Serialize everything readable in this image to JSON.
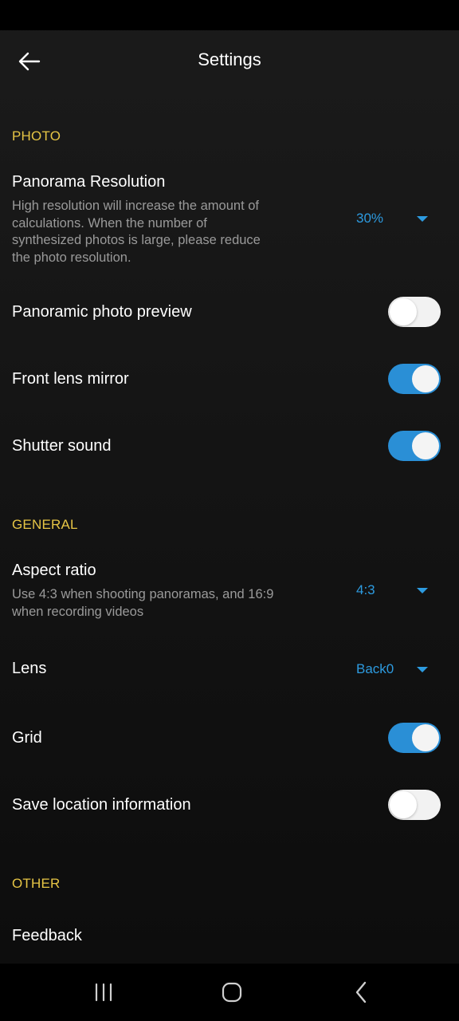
{
  "app_bar": {
    "title": "Settings"
  },
  "sections": {
    "photo": {
      "header": "PHOTO",
      "panorama_resolution": {
        "title": "Panorama Resolution",
        "description": "High resolution will increase the amount of calculations. When the number of synthesized photos is large, please reduce the photo resolution.",
        "value": "30%"
      },
      "panoramic_photo_preview": {
        "title": "Panoramic photo preview",
        "enabled": false
      },
      "front_lens_mirror": {
        "title": "Front lens mirror",
        "enabled": true
      },
      "shutter_sound": {
        "title": "Shutter sound",
        "enabled": true
      }
    },
    "general": {
      "header": "GENERAL",
      "aspect_ratio": {
        "title": "Aspect ratio",
        "description": "Use 4:3 when shooting panoramas, and 16:9 when recording videos",
        "value": "4:3"
      },
      "lens": {
        "title": "Lens",
        "value": "Back0"
      },
      "grid": {
        "title": "Grid",
        "enabled": true
      },
      "save_location": {
        "title": "Save location information",
        "enabled": false
      }
    },
    "other": {
      "header": "OTHER",
      "feedback": {
        "title": "Feedback"
      }
    }
  },
  "colors": {
    "accent_blue": "#2a8fd6",
    "section_header_yellow": "#e6c545",
    "background": "#141414"
  },
  "icons": {
    "back": "arrow-left",
    "nav_recents": "three-vertical-bars",
    "nav_home": "rounded-square",
    "nav_back": "chevron-left"
  }
}
